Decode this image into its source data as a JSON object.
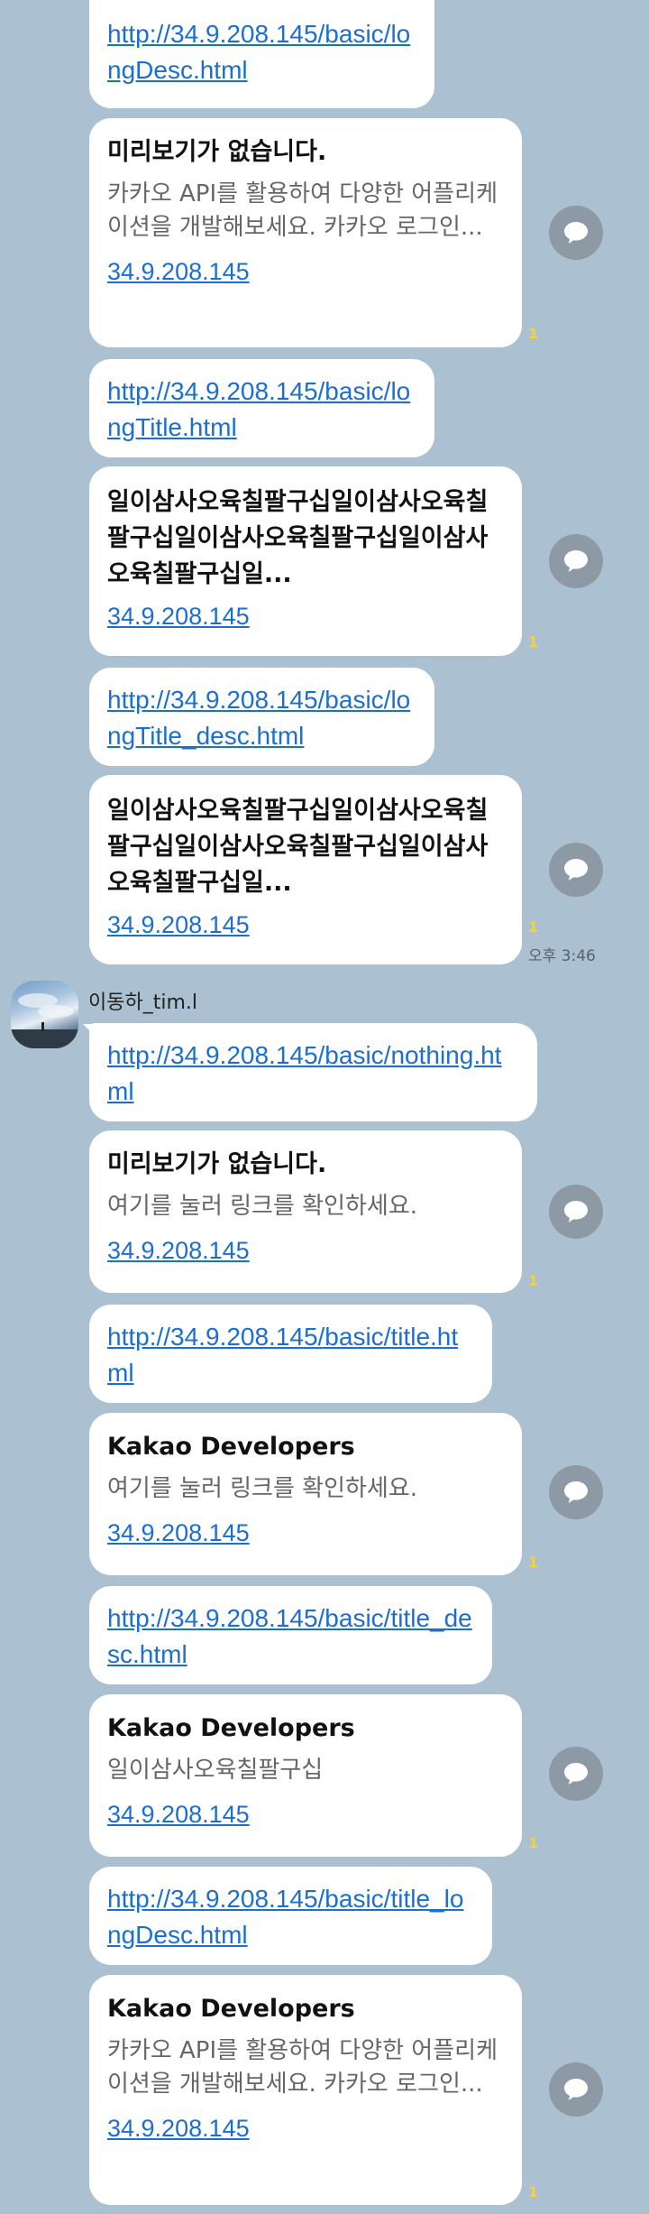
{
  "messages": [
    {
      "kind": "link",
      "text": "http://34.9.208.145/basic/longDesc.html"
    },
    {
      "kind": "card",
      "title": "미리보기가 없습니다.",
      "desc": "카카오 API를 활용하여 다양한 어플리케이션을 개발해보세요. 카카오 로그인...",
      "url": "34.9.208.145",
      "unread": "1"
    },
    {
      "kind": "link",
      "text": "http://34.9.208.145/basic/longTitle.html"
    },
    {
      "kind": "card",
      "title": "일이삼사오육칠팔구십일이삼사오육칠팔구십일이삼사오육칠팔구십일이삼사오육칠팔구십일...",
      "url": "34.9.208.145",
      "unread": "1"
    },
    {
      "kind": "link",
      "text": "http://34.9.208.145/basic/longTitle_desc.html"
    },
    {
      "kind": "card",
      "title": "일이삼사오육칠팔구십일이삼사오육칠팔구십일이삼사오육칠팔구십일이삼사오육칠팔구십일...",
      "url": "34.9.208.145",
      "unread": "1",
      "time": "오후 3:46"
    }
  ],
  "sender": {
    "name": "이동하_tim.l"
  },
  "messages2": [
    {
      "kind": "link",
      "text": "http://34.9.208.145/basic/nothing.html"
    },
    {
      "kind": "card",
      "title": "미리보기가 없습니다.",
      "desc": "여기를 눌러 링크를 확인하세요.",
      "url": "34.9.208.145",
      "unread": "1"
    },
    {
      "kind": "link",
      "text": "http://34.9.208.145/basic/title.html"
    },
    {
      "kind": "card",
      "title": "Kakao Developers",
      "desc": "여기를 눌러 링크를 확인하세요.",
      "url": "34.9.208.145",
      "unread": "1"
    },
    {
      "kind": "link",
      "text": "http://34.9.208.145/basic/title_desc.html"
    },
    {
      "kind": "card",
      "title": "Kakao Developers",
      "desc": "일이삼사오육칠팔구십",
      "url": "34.9.208.145",
      "unread": "1"
    },
    {
      "kind": "link",
      "text": "http://34.9.208.145/basic/title_longDesc.html"
    },
    {
      "kind": "card",
      "title": "Kakao Developers",
      "desc": "카카오 API를 활용하여 다양한 어플리케이션을 개발해보세요. 카카오 로그인...",
      "url": "34.9.208.145",
      "unread": "1"
    }
  ],
  "colors": {
    "background": "#abc1d1",
    "link": "#1a6fd1",
    "unread": "#f5d23a",
    "share_button": "#8d9aa6"
  },
  "icons": {
    "share": "speech-bubble-icon"
  }
}
